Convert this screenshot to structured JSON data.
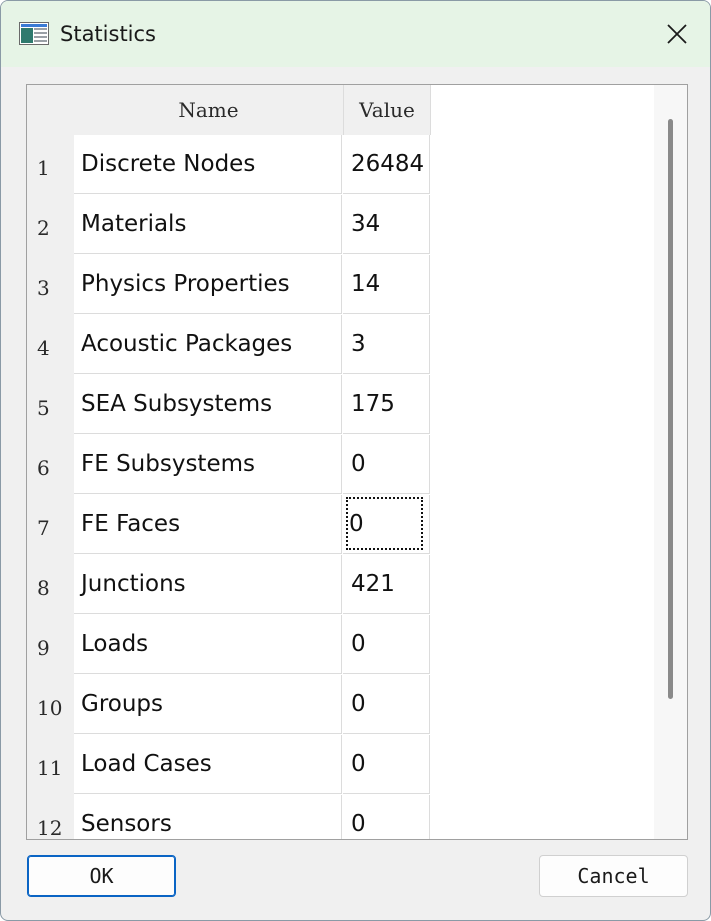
{
  "window": {
    "title": "Statistics",
    "icon": "table-window-icon",
    "close_icon": "close-icon"
  },
  "table": {
    "columns": [
      "Name",
      "Value"
    ],
    "rows": [
      {
        "index": "1",
        "name": "Discrete Nodes",
        "value": "26484"
      },
      {
        "index": "2",
        "name": "Materials",
        "value": "34"
      },
      {
        "index": "3",
        "name": "Physics Properties",
        "value": "14"
      },
      {
        "index": "4",
        "name": "Acoustic Packages",
        "value": "3"
      },
      {
        "index": "5",
        "name": "SEA Subsystems",
        "value": "175"
      },
      {
        "index": "6",
        "name": "FE Subsystems",
        "value": "0"
      },
      {
        "index": "7",
        "name": "FE Faces",
        "value": "0"
      },
      {
        "index": "8",
        "name": "Junctions",
        "value": "421"
      },
      {
        "index": "9",
        "name": "Loads",
        "value": "0"
      },
      {
        "index": "10",
        "name": "Groups",
        "value": "0"
      },
      {
        "index": "11",
        "name": "Load Cases",
        "value": "0"
      },
      {
        "index": "12",
        "name": "Sensors",
        "value": "0"
      }
    ],
    "focused_row": 7
  },
  "buttons": {
    "ok": "OK",
    "cancel": "Cancel"
  },
  "colors": {
    "titlebar": "#e6f4e6",
    "dialog_bg": "#f0f0f0",
    "default_button_border": "#0a64c4"
  }
}
